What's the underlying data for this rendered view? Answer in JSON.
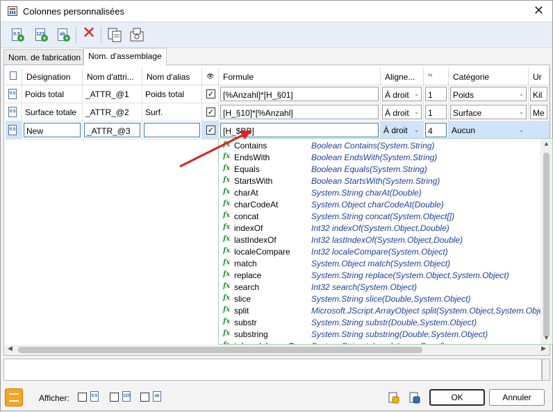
{
  "window": {
    "title": "Colonnes personnalisées",
    "close_label": "✕"
  },
  "toolbar": {
    "buttons": [
      {
        "name": "add-number-column-button",
        "label": "0.5"
      },
      {
        "name": "add-integer-column-button",
        "label": "123"
      },
      {
        "name": "add-text-column-button",
        "label": "ab"
      },
      {
        "name": "delete-column-button",
        "label": "✕"
      },
      {
        "name": "copy-button",
        "label": ""
      },
      {
        "name": "export-button",
        "label": ""
      }
    ]
  },
  "tabs": [
    "Nom. de fabrication",
    "Nom. d'assemblage"
  ],
  "grid": {
    "headers": [
      "",
      "Désignation",
      "Nom d'attri...",
      "Nom d'alias",
      "👁",
      "Formule",
      "Aligne...",
      "⁰⁵",
      "Catégorie",
      "Ur"
    ],
    "rows": [
      {
        "designation": "Poids total",
        "attr": "_ATTR_@1",
        "alias": "Poids total",
        "checked": "✓",
        "formule": "[%Anzahl]*[H_§01]",
        "align": "À droit",
        "dec": "1",
        "categorie": "Poids",
        "unit": "Kil"
      },
      {
        "designation": "Surface totale",
        "attr": "_ATTR_@2",
        "alias": "Surf.",
        "checked": "✓",
        "formule": "[H_§10]*[%Anzahl]",
        "align": "À droit",
        "dec": "1",
        "categorie": "Surface",
        "unit": "Me"
      },
      {
        "designation": "New",
        "attr": "_ATTR_@3",
        "alias": "",
        "checked": "✓",
        "formule": "[H_$BB]",
        "align": "À droit",
        "dec": "4",
        "categorie": "Aucun",
        "unit": ""
      }
    ]
  },
  "autocomplete": {
    "items": [
      {
        "name": "Contains",
        "sig": "Boolean Contains(System.String)"
      },
      {
        "name": "EndsWith",
        "sig": "Boolean EndsWith(System.String)"
      },
      {
        "name": "Equals",
        "sig": "Boolean Equals(System.String)"
      },
      {
        "name": "StartsWith",
        "sig": "Boolean StartsWith(System.String)"
      },
      {
        "name": "charAt",
        "sig": "System.String charAt(Double)"
      },
      {
        "name": "charCodeAt",
        "sig": "System.Object charCodeAt(Double)"
      },
      {
        "name": "concat",
        "sig": "System.String concat(System.Object[])"
      },
      {
        "name": "indexOf",
        "sig": "Int32 indexOf(System.Object,Double)"
      },
      {
        "name": "lastIndexOf",
        "sig": "Int32 lastIndexOf(System.Object,Double)"
      },
      {
        "name": "localeCompare",
        "sig": "Int32 localeCompare(System.Object)"
      },
      {
        "name": "match",
        "sig": "System.Object match(System.Object)"
      },
      {
        "name": "replace",
        "sig": "System.String replace(System.Object,System.Object)"
      },
      {
        "name": "search",
        "sig": "Int32 search(System.Object)"
      },
      {
        "name": "slice",
        "sig": "System.String slice(Double,System.Object)"
      },
      {
        "name": "split",
        "sig": "Microsoft.JScript.ArrayObject split(System.Object,System.Object)"
      },
      {
        "name": "substr",
        "sig": "System.String substr(Double,System.Object)"
      },
      {
        "name": "substring",
        "sig": "System.String substring(Double,System.Object)"
      },
      {
        "name": "toLocaleLowerCase",
        "sig": "System.String toLocaleLowerCase()"
      }
    ]
  },
  "footer": {
    "afficher_label": "Afficher:",
    "filter_icons": [
      "0.5",
      "123",
      "ab"
    ],
    "ok_label": "OK",
    "cancel_label": "Annuler"
  },
  "colors": {
    "selection": "#cfe3fb",
    "toolbar": "#e8eef8",
    "signature": "#1a3fa5",
    "fx": "#2e8b3a",
    "arrow": "#e0201c"
  }
}
